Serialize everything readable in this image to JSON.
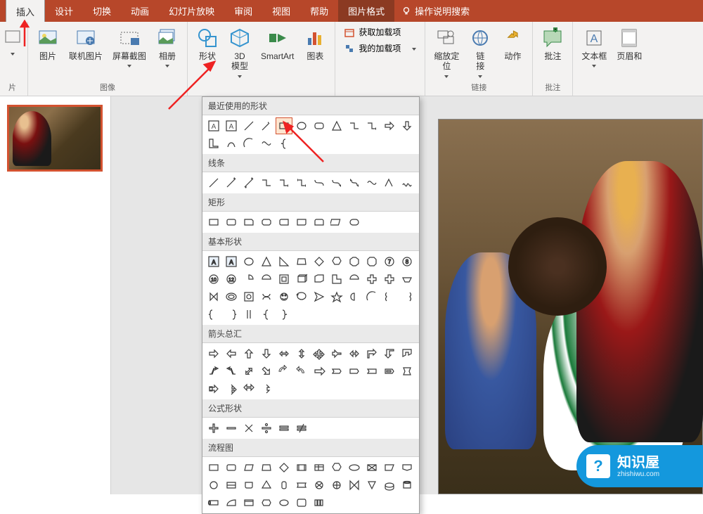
{
  "tabs": {
    "insert": "插入",
    "design": "设计",
    "transitions": "切换",
    "animations": "动画",
    "slideshow": "幻灯片放映",
    "review": "审阅",
    "view": "视图",
    "help": "帮助",
    "pictureformat": "图片格式",
    "tellme": "操作说明搜索"
  },
  "ribbon": {
    "images": {
      "label": "图像",
      "pictures": "图片",
      "online": "联机图片",
      "screenshot": "屏幕截图",
      "album": "相册"
    },
    "illustrations": {
      "shapes": "形状",
      "models3d": "3D\n模型",
      "smartart": "SmartArt",
      "chart": "图表"
    },
    "addins": {
      "get": "获取加载项",
      "my": "我的加载项"
    },
    "links": {
      "label": "链接",
      "zoom": "缩放定\n位",
      "link": "链\n接",
      "action": "动作"
    },
    "comments": {
      "label": "批注",
      "comment": "批注"
    },
    "text": {
      "textbox": "文本框",
      "hf": "页眉和"
    }
  },
  "shapes_dropdown": {
    "recent": "最近使用的形状",
    "lines": "线条",
    "rectangles": "矩形",
    "basic": "基本形状",
    "block_arrows": "箭头总汇",
    "equation": "公式形状",
    "flowchart": "流程图"
  },
  "watermark": {
    "title": "知识屋",
    "url": "zhishiwu.com"
  }
}
